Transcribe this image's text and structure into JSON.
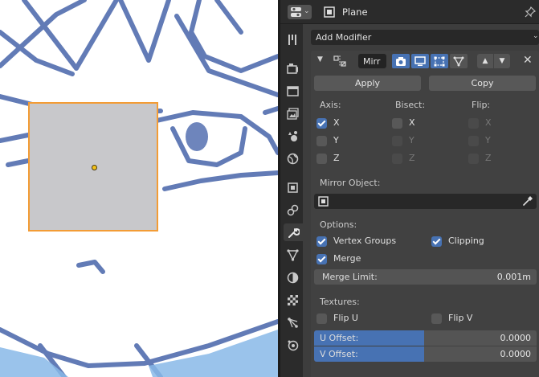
{
  "header": {
    "object_name": "Plane"
  },
  "add_modifier": {
    "label": "Add Modifier"
  },
  "modifier": {
    "name": "Mirr",
    "apply_label": "Apply",
    "copy_label": "Copy",
    "axis_heading": "Axis:",
    "bisect_heading": "Bisect:",
    "flip_heading": "Flip:",
    "axis": [
      {
        "label": "X",
        "checked": true
      },
      {
        "label": "Y",
        "checked": false
      },
      {
        "label": "Z",
        "checked": false
      }
    ],
    "bisect": [
      {
        "label": "X",
        "checked": false
      },
      {
        "label": "Y",
        "checked": false
      },
      {
        "label": "Z",
        "checked": false
      }
    ],
    "flip": [
      {
        "label": "X",
        "checked": false
      },
      {
        "label": "Y",
        "checked": false
      },
      {
        "label": "Z",
        "checked": false
      }
    ],
    "mirror_object_label": "Mirror Object:",
    "options_heading": "Options:",
    "vertex_groups_label": "Vertex Groups",
    "vertex_groups_checked": true,
    "clipping_label": "Clipping",
    "clipping_checked": true,
    "merge_label": "Merge",
    "merge_checked": true,
    "merge_limit_label": "Merge Limit:",
    "merge_limit_value": "0.001m",
    "textures_heading": "Textures:",
    "flip_u_label": "Flip U",
    "flip_u_checked": false,
    "flip_v_label": "Flip V",
    "flip_v_checked": false,
    "u_offset_label": "U Offset:",
    "u_offset_value": "0.0000",
    "v_offset_label": "V Offset:",
    "v_offset_value": "0.0000"
  },
  "tabs": [
    "tool-icon",
    "render-icon",
    "output-icon",
    "view-layer-icon",
    "scene-icon",
    "world-icon",
    "object-icon",
    "constraints-icon",
    "modifier-icon",
    "particles-icon",
    "physics-icon",
    "object-data-icon",
    "material-icon",
    "texture-icon"
  ],
  "colors": {
    "accent": "#4772b3",
    "selection_outline": "#f39c35",
    "panel_bg": "#3d3d3d",
    "sketch_stroke": "#5570b0"
  }
}
